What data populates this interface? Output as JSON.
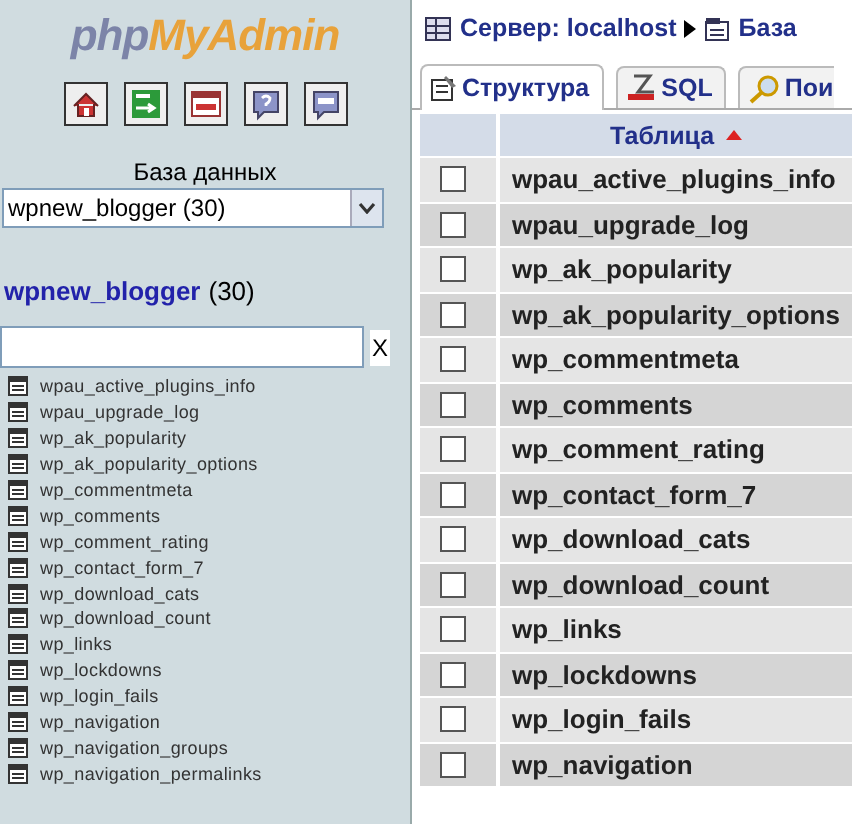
{
  "sidebar": {
    "logo": {
      "part_1": "php",
      "part_2": "MyAdmin"
    },
    "database_label": "База данных",
    "database_select": "wpnew_blogger (30)",
    "db_link": "wpnew_blogger",
    "db_count": "(30)",
    "filter": {
      "clear": "X"
    },
    "tables": [
      "wpau_active_plugins_info",
      "wpau_upgrade_log",
      "wp_ak_popularity",
      "wp_ak_popularity_options",
      "wp_commentmeta",
      "wp_comments",
      "wp_comment_rating",
      "wp_contact_form_7",
      "wp_download_cats",
      "wp_download_count",
      "wp_links",
      "wp_lockdowns",
      "wp_login_fails",
      "wp_navigation",
      "wp_navigation_groups",
      "wp_navigation_permalinks"
    ]
  },
  "breadcrumb": {
    "server": "Сервер: localhost",
    "database": "База"
  },
  "tabs": [
    {
      "label": "Структура",
      "kind": "structure",
      "selected": true
    },
    {
      "label": "SQL",
      "kind": "sql",
      "selected": false
    },
    {
      "label": "Пои",
      "kind": "search",
      "selected": false
    }
  ],
  "table": {
    "columns": [
      "Таблица"
    ],
    "rows": [
      {
        "name": "wpau_active_plugins_info",
        "checked": false
      },
      {
        "name": "wpau_upgrade_log",
        "checked": false
      },
      {
        "name": "wp_ak_popularity",
        "checked": false
      },
      {
        "name": "wp_ak_popularity_options",
        "checked": false
      },
      {
        "name": "wp_commentmeta",
        "checked": false
      },
      {
        "name": "wp_comments",
        "checked": false
      },
      {
        "name": "wp_comment_rating",
        "checked": false
      },
      {
        "name": "wp_contact_form_7",
        "checked": false
      },
      {
        "name": "wp_download_cats",
        "checked": false
      },
      {
        "name": "wp_download_count",
        "checked": false
      },
      {
        "name": "wp_links",
        "checked": false
      },
      {
        "name": "wp_lockdowns",
        "checked": false
      },
      {
        "name": "wp_login_fails",
        "checked": false
      },
      {
        "name": "wp_navigation",
        "checked": false
      }
    ]
  }
}
